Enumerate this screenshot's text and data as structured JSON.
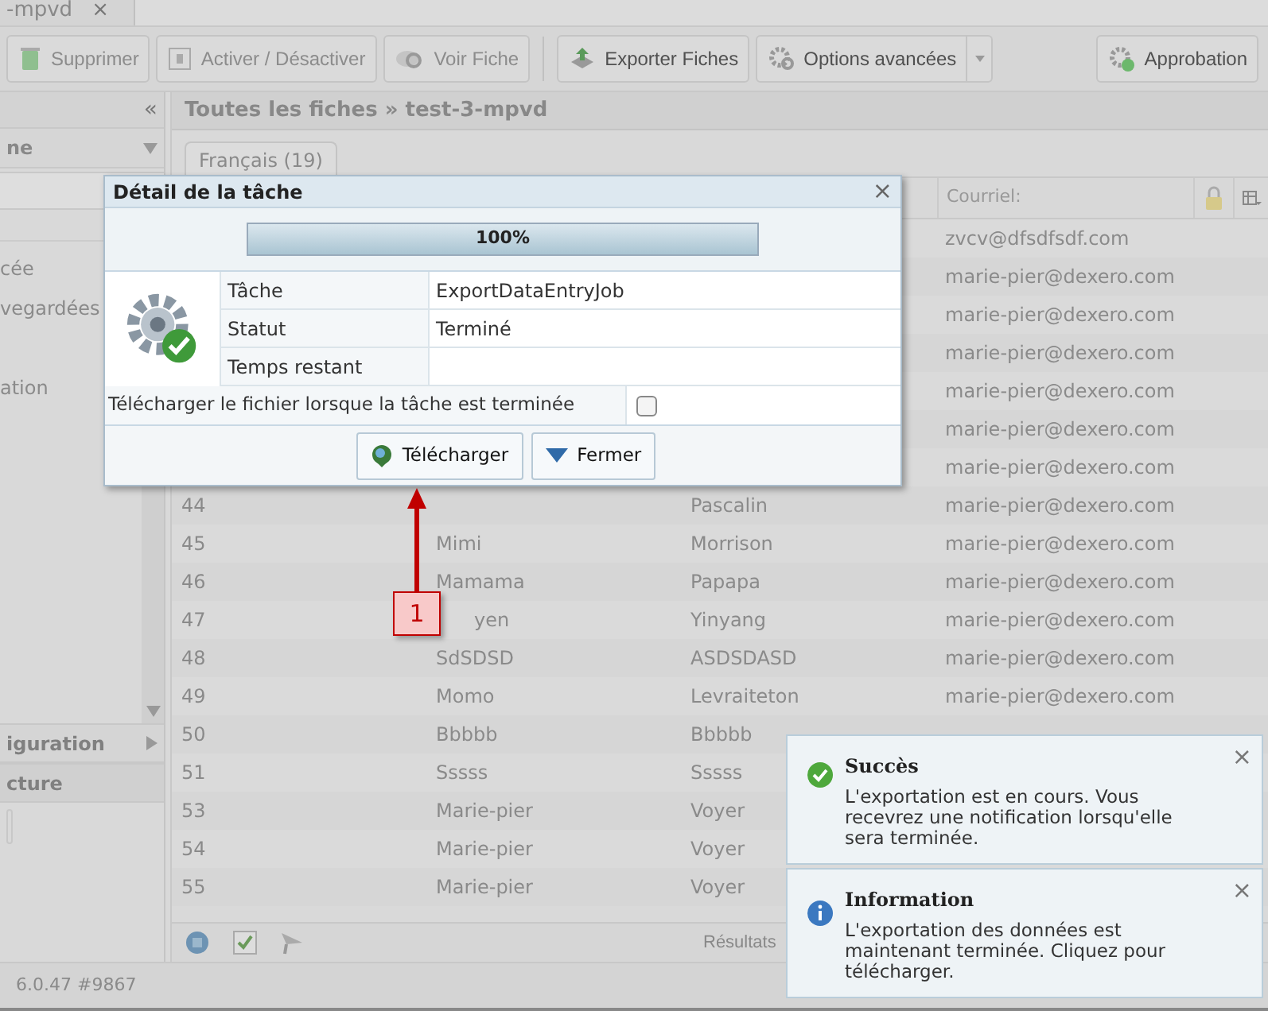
{
  "doc_tab": {
    "label": "-mpvd",
    "close": "×"
  },
  "toolbar": [
    {
      "label": "Supprimer",
      "disabled": true
    },
    {
      "label": "Activer / Désactiver",
      "disabled": true
    },
    {
      "label": "Voir Fiche",
      "disabled": true
    },
    {
      "label": "Exporter Fiches",
      "disabled": false
    },
    {
      "label": "Options avancées",
      "disabled": false,
      "dropdown": true
    },
    {
      "label": "Approbation",
      "disabled": false
    }
  ],
  "sidebar": {
    "collapse": "«",
    "section": "ne",
    "items": [
      {
        "label": "cée"
      },
      {
        "label": "vegardées"
      },
      {
        "label": "ation"
      }
    ],
    "panels": [
      {
        "label": "iguration",
        "expanded": false
      },
      {
        "label": "cture",
        "expanded": true
      }
    ]
  },
  "breadcrumb": "Toutes les fiches » test-3-mpvd",
  "language_tab": {
    "label": "Français (19)",
    "selected": true
  },
  "table": {
    "columns": [
      "Courriel:"
    ],
    "rows": [
      {
        "email": "zvcv@dfsdfsdf.com"
      },
      {
        "email": "marie-pier@dexero.com"
      },
      {
        "email": "marie-pier@dexero.com"
      },
      {
        "email": "marie-pier@dexero.com"
      },
      {
        "email": "marie-pier@dexero.com"
      },
      {
        "email": "marie-pier@dexero.com"
      },
      {
        "email": "marie-pier@dexero.com"
      },
      {
        "number": "44",
        "last_name": "Pascalin",
        "email": "marie-pier@dexero.com"
      },
      {
        "number": "45",
        "first_name": "Mimi",
        "last_name": "Morrison",
        "email": "marie-pier@dexero.com"
      },
      {
        "number": "46",
        "first_name": "Mamama",
        "last_name": "Papapa",
        "email": "marie-pier@dexero.com"
      },
      {
        "number": "47",
        "first_name": "yen",
        "last_name": "Yinyang",
        "email": "marie-pier@dexero.com"
      },
      {
        "number": "48",
        "first_name": "SdSDSD",
        "last_name": "ASDSDASD",
        "email": "marie-pier@dexero.com"
      },
      {
        "number": "49",
        "first_name": "Momo",
        "last_name": "Levraiteton",
        "email": "marie-pier@dexero.com"
      },
      {
        "number": "50",
        "first_name": "Bbbbb",
        "last_name": "Bbbbb"
      },
      {
        "number": "51",
        "first_name": "Sssss",
        "last_name": "Sssss"
      },
      {
        "number": "53",
        "first_name": "Marie-pier",
        "last_name": "Voyer"
      },
      {
        "number": "54",
        "first_name": "Marie-pier",
        "last_name": "Voyer"
      },
      {
        "number": "55",
        "first_name": "Marie-pier",
        "last_name": "Voyer"
      }
    ],
    "footer": "Résultats"
  },
  "status_bar": "6.0.47 #9867",
  "dialog": {
    "title": "Détail de la tâche",
    "close": "×",
    "progress": {
      "level": 1.0,
      "label": "100%"
    },
    "fields": [
      {
        "label": "Tâche",
        "value": "ExportDataEntryJob"
      },
      {
        "label": "Statut",
        "value": "Terminé"
      },
      {
        "label": "Temps restant"
      }
    ],
    "download_option": {
      "label": "Télécharger le fichier lorsque la tâche est terminée",
      "checked": false
    },
    "buttons": [
      {
        "label": "Télécharger"
      },
      {
        "label": "Fermer"
      }
    ]
  },
  "annotation": {
    "label": "1"
  },
  "notifications": [
    {
      "kind": "success",
      "title": "Succès",
      "message": "L'exportation est en cours. Vous recevrez une notification lorsqu'elle sera terminée.",
      "close": "×"
    },
    {
      "kind": "info",
      "title": "Information",
      "message": "L'exportation des données est maintenant terminée. Cliquez pour télécharger.",
      "close": "×"
    }
  ]
}
